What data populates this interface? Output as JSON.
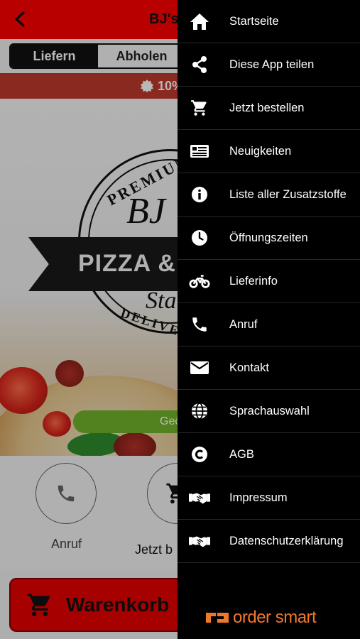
{
  "header": {
    "title": "BJ's"
  },
  "order_mode": {
    "deliver_label": "Liefern",
    "pickup_label": "Abholen",
    "active": "deliver"
  },
  "promo": {
    "text": "10%"
  },
  "logo": {
    "arc_top": "PREMIUM",
    "initials": "BJ",
    "banner": "PIZZA &",
    "script": "Sta",
    "arc_bottom": "DELIVER"
  },
  "status_pill": {
    "label": "Geö"
  },
  "actions": {
    "call_label": "Anruf",
    "order_label": "Jetzt b"
  },
  "cart": {
    "label": "Warenkorb"
  },
  "drawer": {
    "items": [
      {
        "label": "Startseite",
        "icon": "home-icon"
      },
      {
        "label": "Diese App teilen",
        "icon": "share-icon"
      },
      {
        "label": "Jetzt bestellen",
        "icon": "cart-icon"
      },
      {
        "label": "Neuigkeiten",
        "icon": "news-icon"
      },
      {
        "label": "Liste aller Zusatzstoffe",
        "icon": "info-icon"
      },
      {
        "label": "Öffnungszeiten",
        "icon": "clock-icon"
      },
      {
        "label": "Lieferinfo",
        "icon": "motorcycle-icon"
      },
      {
        "label": "Anruf",
        "icon": "phone-icon"
      },
      {
        "label": "Kontakt",
        "icon": "mail-icon"
      },
      {
        "label": "Sprachauswahl",
        "icon": "globe-icon"
      },
      {
        "label": "AGB",
        "icon": "copyright-icon"
      },
      {
        "label": "Impressum",
        "icon": "handshake-icon"
      },
      {
        "label": "Datenschutzerklärung",
        "icon": "handshake-icon"
      }
    ],
    "brand": "order smart"
  },
  "colors": {
    "topbar": "#ff0000",
    "promo": "#c0392b",
    "drawer": "#000000",
    "brand": "#f0782a",
    "pill": "#72b52b",
    "cart": "#e60000"
  }
}
